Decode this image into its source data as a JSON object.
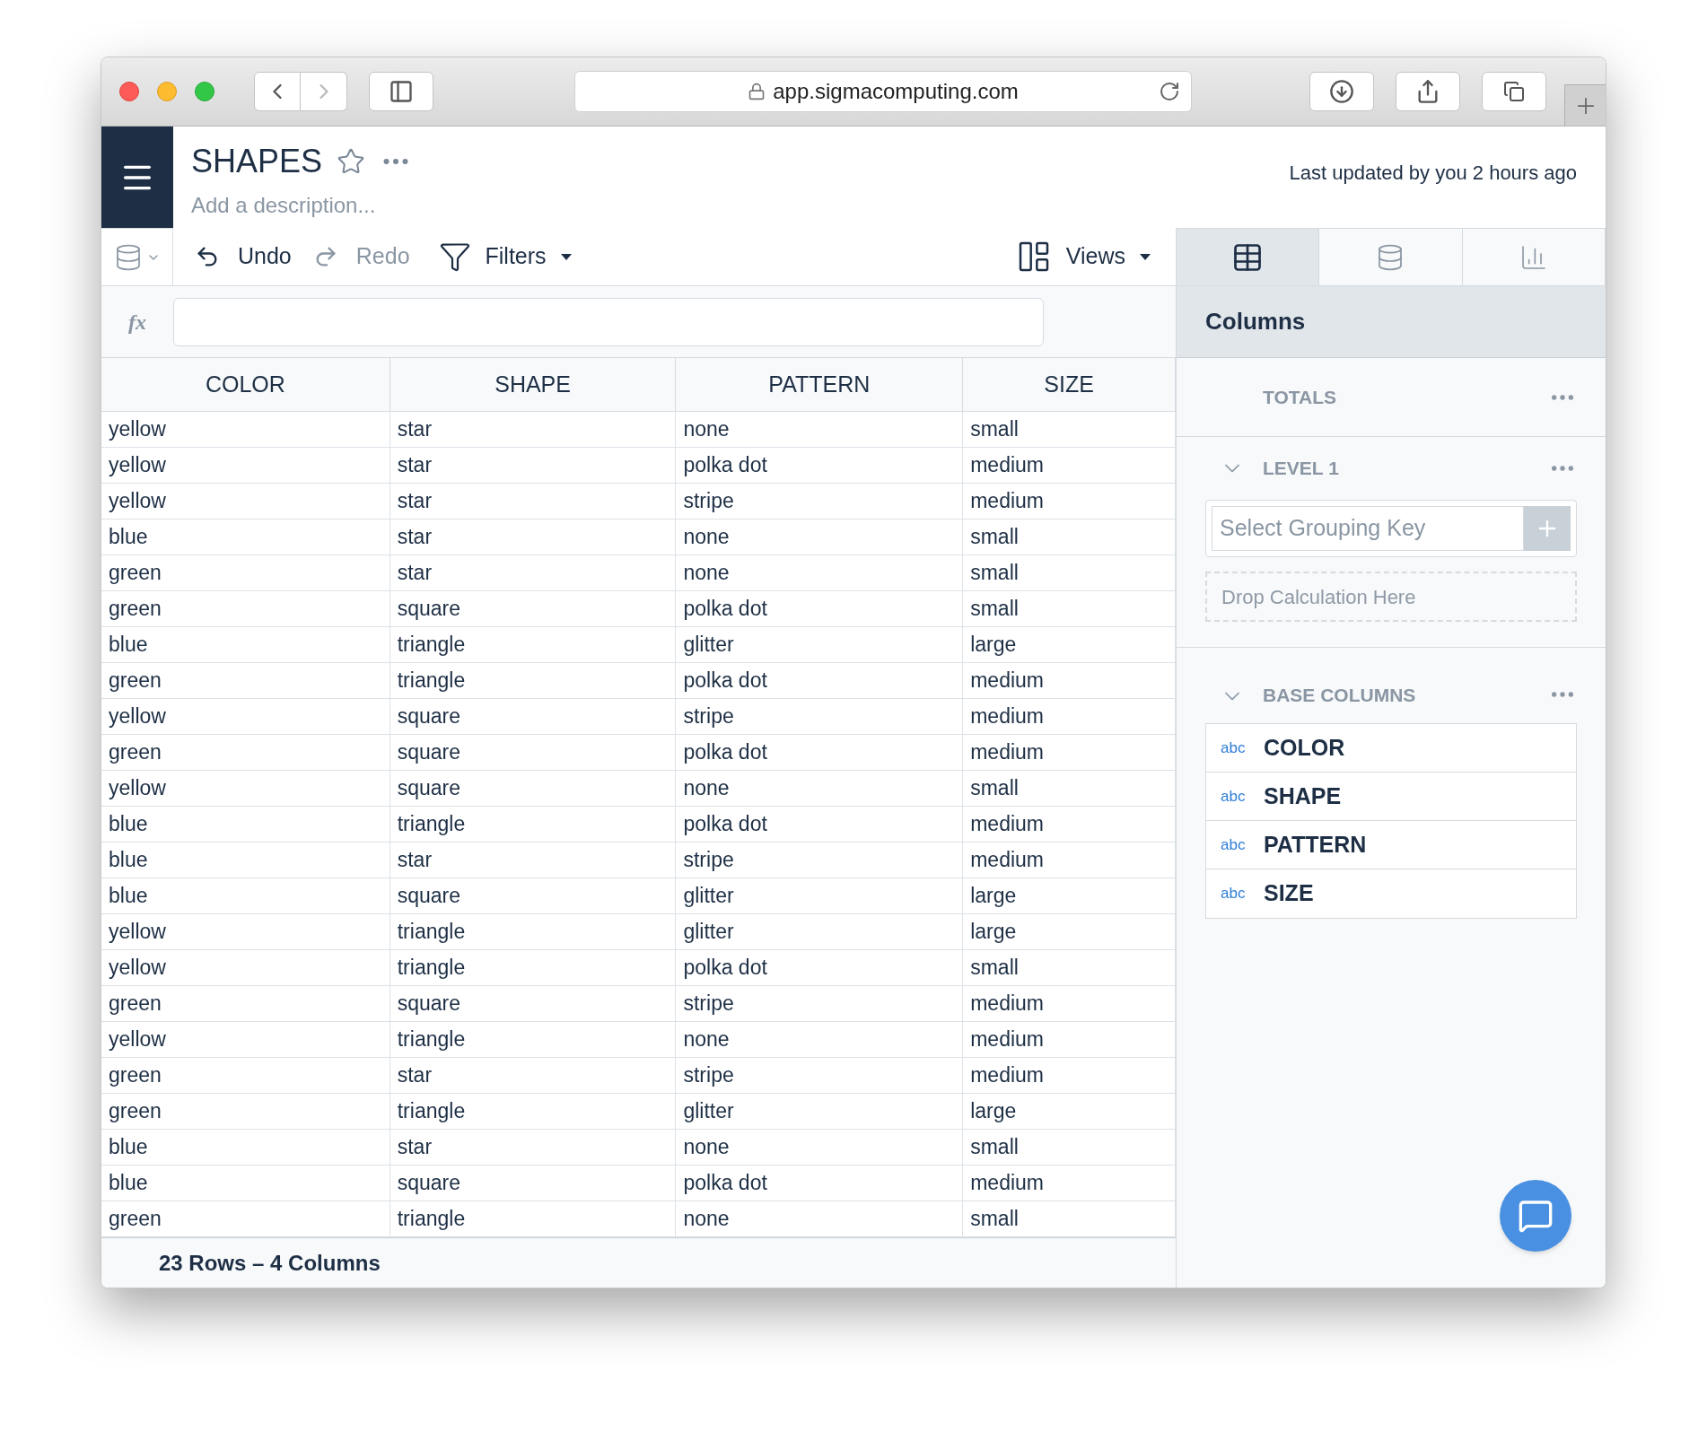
{
  "browser": {
    "url": "app.sigmacomputing.com"
  },
  "header": {
    "title": "SHAPES",
    "description_placeholder": "Add a description...",
    "last_updated": "Last updated by you 2 hours ago"
  },
  "toolbar": {
    "undo": {
      "label": "Undo",
      "disabled": false
    },
    "redo": {
      "label": "Redo",
      "disabled": true
    },
    "filters": "Filters",
    "views": "Views"
  },
  "formula_bar": {
    "label": "fx"
  },
  "panel_tabs": [
    {
      "kind": "table",
      "selected": true
    },
    {
      "kind": "database",
      "selected": false
    },
    {
      "kind": "chart",
      "selected": false
    }
  ],
  "panel": {
    "title": "Columns",
    "totals": "TOTALS",
    "level": {
      "label": "LEVEL 1",
      "expanded": true,
      "grouping_placeholder": "Select Grouping Key",
      "drop_hint": "Drop Calculation Here"
    },
    "base_columns": {
      "label": "BASE COLUMNS",
      "expanded": true,
      "items": [
        {
          "type": "abc",
          "name": "COLOR"
        },
        {
          "type": "abc",
          "name": "SHAPE"
        },
        {
          "type": "abc",
          "name": "PATTERN"
        },
        {
          "type": "abc",
          "name": "SIZE"
        }
      ]
    }
  },
  "table": {
    "columns": [
      "COLOR",
      "SHAPE",
      "PATTERN",
      "SIZE"
    ],
    "rows": [
      [
        "yellow",
        "star",
        "none",
        "small"
      ],
      [
        "yellow",
        "star",
        "polka dot",
        "medium"
      ],
      [
        "yellow",
        "star",
        "stripe",
        "medium"
      ],
      [
        "blue",
        "star",
        "none",
        "small"
      ],
      [
        "green",
        "star",
        "none",
        "small"
      ],
      [
        "green",
        "square",
        "polka dot",
        "small"
      ],
      [
        "blue",
        "triangle",
        "glitter",
        "large"
      ],
      [
        "green",
        "triangle",
        "polka dot",
        "medium"
      ],
      [
        "yellow",
        "square",
        "stripe",
        "medium"
      ],
      [
        "green",
        "square",
        "polka dot",
        "medium"
      ],
      [
        "yellow",
        "square",
        "none",
        "small"
      ],
      [
        "blue",
        "triangle",
        "polka dot",
        "medium"
      ],
      [
        "blue",
        "star",
        "stripe",
        "medium"
      ],
      [
        "blue",
        "square",
        "glitter",
        "large"
      ],
      [
        "yellow",
        "triangle",
        "glitter",
        "large"
      ],
      [
        "yellow",
        "triangle",
        "polka dot",
        "small"
      ],
      [
        "green",
        "square",
        "stripe",
        "medium"
      ],
      [
        "yellow",
        "triangle",
        "none",
        "medium"
      ],
      [
        "green",
        "star",
        "stripe",
        "medium"
      ],
      [
        "green",
        "triangle",
        "glitter",
        "large"
      ],
      [
        "blue",
        "star",
        "none",
        "small"
      ],
      [
        "blue",
        "square",
        "polka dot",
        "medium"
      ],
      [
        "green",
        "triangle",
        "none",
        "small"
      ]
    ]
  },
  "footer": "23 Rows – 4 Columns"
}
